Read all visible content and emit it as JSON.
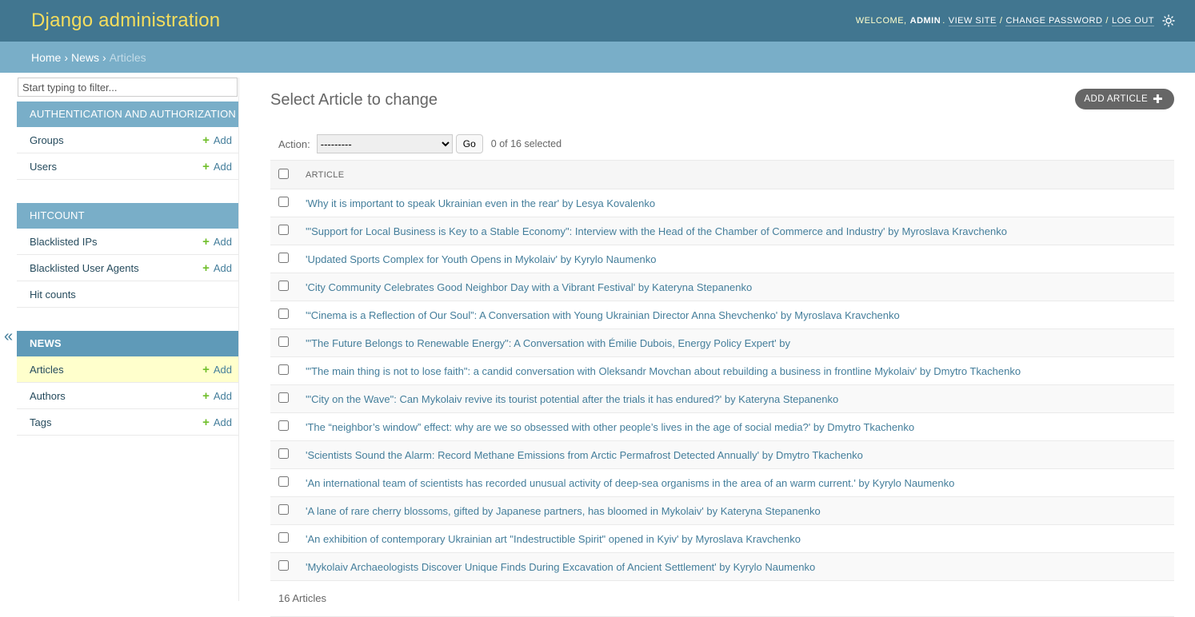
{
  "header": {
    "branding": "Django administration",
    "welcome": "Welcome,",
    "username": "admin",
    "view_site": "View site",
    "change_password": "Change password",
    "log_out": "Log out",
    "sep": "/",
    "theme_icon": "sun-icon"
  },
  "breadcrumbs": {
    "home": "Home",
    "news": "News",
    "current": "Articles",
    "sep": "›"
  },
  "sidebar": {
    "filter_placeholder": "Start typing to filter...",
    "collapse_label": "«",
    "add_label": "Add",
    "modules": [
      {
        "caption": "Authentication and Authorization",
        "models": [
          {
            "name": "Groups",
            "has_add": true
          },
          {
            "name": "Users",
            "has_add": true
          }
        ]
      },
      {
        "caption": "Hitcount",
        "models": [
          {
            "name": "Blacklisted IPs",
            "has_add": true
          },
          {
            "name": "Blacklisted User Agents",
            "has_add": true
          },
          {
            "name": "Hit counts",
            "has_add": false
          }
        ]
      },
      {
        "caption": "News",
        "current": true,
        "models": [
          {
            "name": "Articles",
            "has_add": true,
            "selected": true
          },
          {
            "name": "Authors",
            "has_add": true
          },
          {
            "name": "Tags",
            "has_add": true
          }
        ]
      }
    ]
  },
  "content": {
    "title": "Select Article to change",
    "add_button": "Add Article",
    "action_label": "Action:",
    "action_selected": "---------",
    "go_label": "Go",
    "counter": "0 of 16 selected",
    "column_header": "Article",
    "rows": [
      "'Why it is important to speak Ukrainian even in the rear' by Lesya Kovalenko",
      "'\"Support for Local Business is Key to a Stable Economy\": Interview with the Head of the Chamber of Commerce and Industry' by Myroslava Kravchenko",
      "'Updated Sports Complex for Youth Opens in Mykolaiv' by Kyrylo Naumenko",
      "'City Community Celebrates Good Neighbor Day with a Vibrant Festival' by Kateryna Stepanenko",
      "'“Cinema is a Reflection of Our Soul”: A Conversation with Young Ukrainian Director Anna Shevchenko' by Myroslava Kravchenko",
      "'\"The Future Belongs to Renewable Energy\": A Conversation with Émilie Dubois, Energy Policy Expert' by",
      "'\"The main thing is not to lose faith\": a candid conversation with Oleksandr Movchan about rebuilding a business in frontline Mykolaiv' by Dmytro Tkachenko",
      "'\"City on the Wave\": Can Mykolaiv revive its tourist potential after the trials it has endured?' by Kateryna Stepanenko",
      "'The “neighbor’s window” effect: why are we so obsessed with other people’s lives in the age of social media?' by Dmytro Tkachenko",
      "'Scientists Sound the Alarm: Record Methane Emissions from Arctic Permafrost Detected Annually' by Dmytro Tkachenko",
      "'An international team of scientists has recorded unusual activity of deep-sea organisms in the area of an warm current.' by Kyrylo Naumenko",
      "'A lane of rare cherry blossoms, gifted by Japanese partners, has bloomed in Mykolaiv' by Kateryna Stepanenko",
      "'An exhibition of contemporary Ukrainian art \"Indestructible Spirit\" opened in Kyiv' by Myroslava Kravchenko",
      "'Mykolaiv Archaeologists Discover Unique Finds During Excavation of Ancient Settlement' by Kyrylo Naumenko"
    ],
    "paginator": "16 Articles"
  },
  "colors": {
    "header_bg": "#417690",
    "breadcrumbs_bg": "#79aec8",
    "branding": "#f5dd5d",
    "link": "#447e9b",
    "add_plus": "#70bf2b",
    "selected_row": "#ffffcc"
  }
}
